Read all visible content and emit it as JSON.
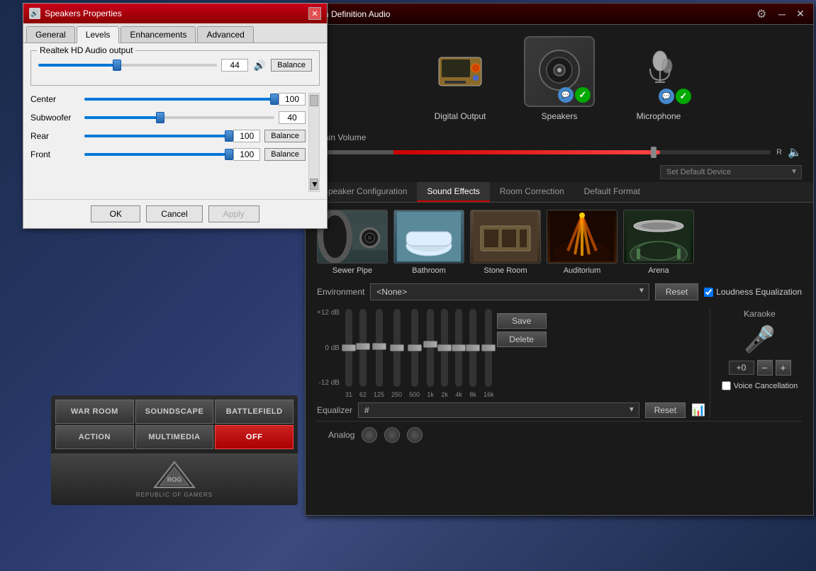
{
  "speakers_window": {
    "title": "Speakers Properties",
    "tabs": [
      "General",
      "Levels",
      "Enhancements",
      "Advanced"
    ],
    "active_tab": "Levels",
    "realtek_group": "Realtek HD Audio output",
    "main_volume_value": "44",
    "sliders": [
      {
        "label": "Center",
        "value": 100,
        "percent": 100
      },
      {
        "label": "Subwoofer",
        "value": 40,
        "percent": 40
      },
      {
        "label": "Rear",
        "value": 100,
        "percent": 100,
        "has_balance": true
      },
      {
        "label": "Front",
        "value": 100,
        "percent": 100,
        "has_balance": true
      }
    ],
    "buttons": {
      "ok": "OK",
      "cancel": "Cancel",
      "apply": "Apply"
    }
  },
  "hda_window": {
    "title": "High Definition Audio",
    "devices": [
      {
        "label": "Digital Output",
        "active": false,
        "check": false,
        "bubble": false
      },
      {
        "label": "Speakers",
        "active": true,
        "check": true,
        "bubble": true
      },
      {
        "label": "Microphone",
        "active": false,
        "check": true,
        "bubble": true
      }
    ],
    "main_volume_label": "Main Volume",
    "default_device_placeholder": "Set Default Device",
    "tabs": [
      "Speaker Configuration",
      "Sound Effects",
      "Room Correction",
      "Default Format"
    ],
    "active_tab": "Sound Effects",
    "environments": [
      {
        "label": "Sewer Pipe"
      },
      {
        "label": "Bathroom"
      },
      {
        "label": "Stone Room"
      },
      {
        "label": "Auditorium"
      },
      {
        "label": "Arena"
      }
    ],
    "environment_select": "<None>",
    "reset_btn": "Reset",
    "loudness_eq": "Loudness Equalization",
    "eq_db_labels": [
      "+12 dB",
      "0 dB",
      "-12 dB"
    ],
    "eq_freqs": [
      "31",
      "62",
      "125",
      "250",
      "500",
      "1k",
      "2k",
      "4k",
      "8k",
      "16k"
    ],
    "eq_fader_positions": [
      55,
      50,
      50,
      50,
      50,
      45,
      50,
      50,
      50,
      50
    ],
    "eq_label": "Equalizer",
    "eq_select_value": "#",
    "save_btn": "Save",
    "delete_btn": "Delete",
    "karaoke_label": "Karaoke",
    "karaoke_value": "+0",
    "voice_cancel": "Voice Cancellation",
    "analog_label": "Analog"
  },
  "rog_panel": {
    "buttons": [
      "WAR ROOM",
      "SOUNDSCAPE",
      "BATTLEFIELD",
      "ACTION",
      "MULTIMEDIA",
      "OFF"
    ]
  }
}
